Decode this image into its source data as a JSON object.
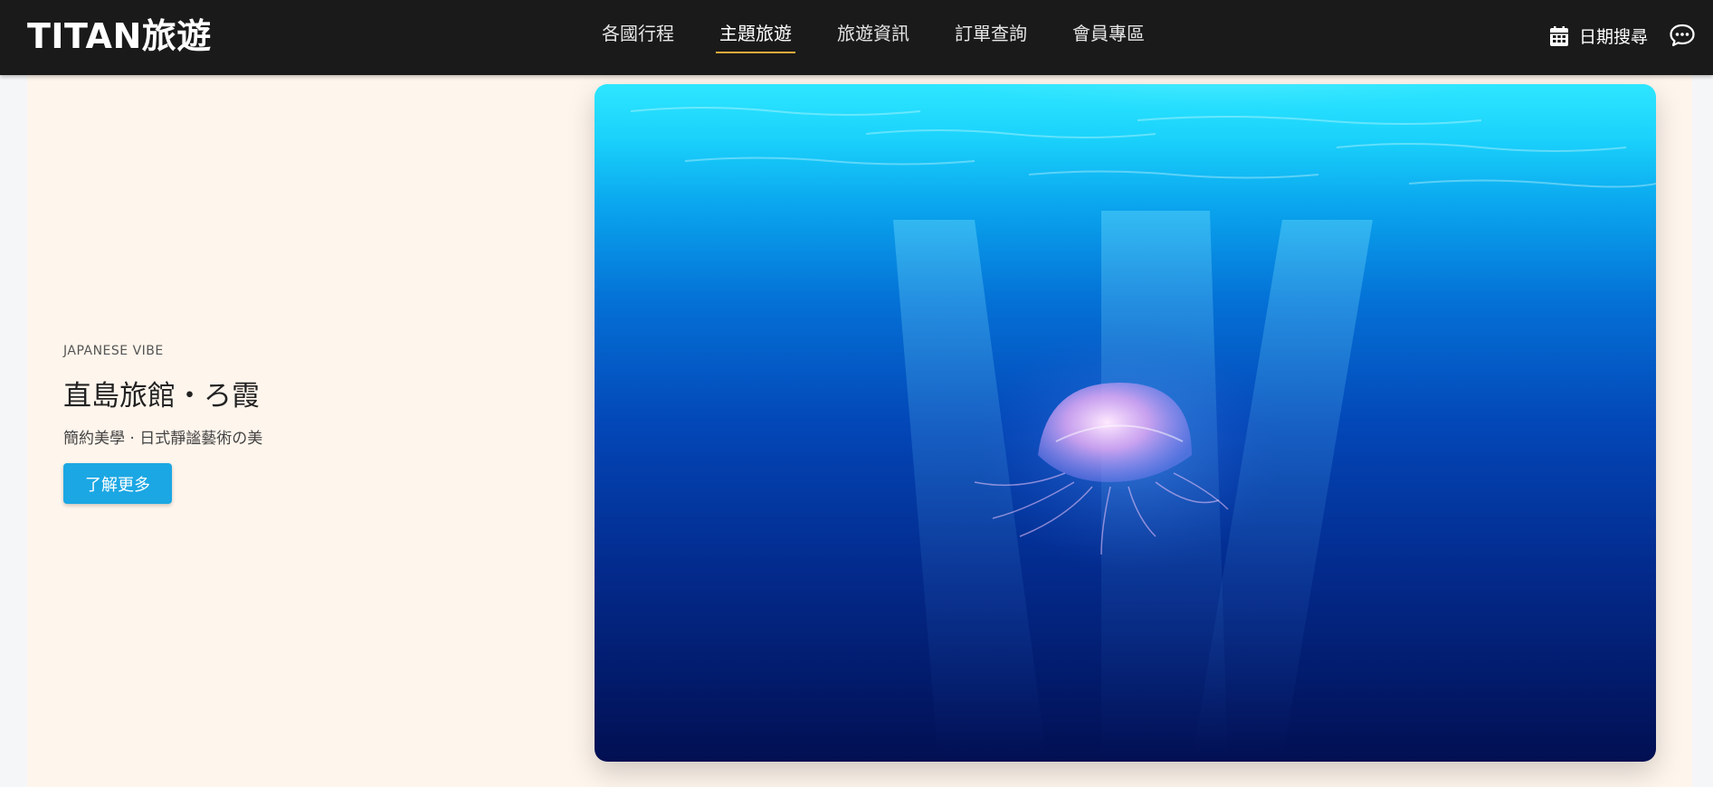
{
  "header": {
    "logo": "TITAN旅遊",
    "nav": [
      {
        "label": "各國行程",
        "active": false
      },
      {
        "label": "主題旅遊",
        "active": true
      },
      {
        "label": "旅遊資訊",
        "active": false
      },
      {
        "label": "訂單查詢",
        "active": false
      },
      {
        "label": "會員專區",
        "active": false
      }
    ],
    "date_search": {
      "label": "日期搜尋",
      "icon": "calendar-icon"
    },
    "chat": {
      "icon": "chat-icon"
    },
    "active_underline_color": "#e5a93b",
    "background_color": "#1a1a1a"
  },
  "hero": {
    "eyebrow": "JAPANESE VIBE",
    "title": "直島旅館・ろ霞",
    "subtitle": "簡約美學 · 日式靜謐藝術の美",
    "cta_label": "了解更多",
    "cta_color": "#1ba7e3",
    "background_color": "#fef5ec",
    "image": {
      "subject": "jellyfish underwater",
      "icon": "jellyfish-photo"
    }
  }
}
